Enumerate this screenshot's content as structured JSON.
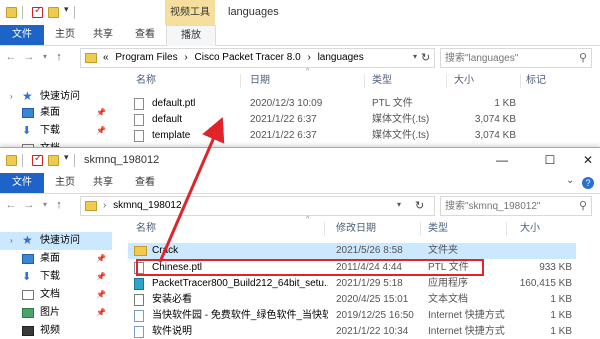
{
  "colors": {
    "accent": "#1e64c8",
    "context_tab": "#f6df9d",
    "selection": "#cce8ff",
    "highlight": "#e0242a"
  },
  "window1": {
    "title": "languages",
    "context_tab": "视频工具",
    "tabs": [
      "文件",
      "主页",
      "共享",
      "查看",
      "播放"
    ],
    "path": [
      "«",
      "Program Files",
      "›",
      "Cisco Packet Tracer 8.0",
      "›",
      "languages"
    ],
    "search_placeholder": "搜索\"languages\"",
    "columns": [
      "名称",
      "日期",
      "类型",
      "大小",
      "标记"
    ],
    "sidebar": [
      "快速访问",
      "桌面",
      "下载",
      "文档"
    ],
    "files": [
      {
        "name": "default.ptl",
        "date": "2020/12/3 10:09",
        "type": "PTL 文件",
        "size": "1 KB",
        "icon": "file-icon"
      },
      {
        "name": "default",
        "date": "2021/1/22 6:37",
        "type": "媒体文件(.ts)",
        "size": "3,074 KB",
        "icon": "file-icon"
      },
      {
        "name": "template",
        "date": "2021/1/22 6:37",
        "type": "媒体文件(.ts)",
        "size": "3,074 KB",
        "icon": "file-icon"
      }
    ]
  },
  "window2": {
    "title": "skmnq_198012",
    "tabs": [
      "文件",
      "主页",
      "共享",
      "查看"
    ],
    "path": [
      "skmnq_198012"
    ],
    "search_placeholder": "搜索\"skmnq_198012\"",
    "columns": [
      "名称",
      "修改日期",
      "类型",
      "大小"
    ],
    "sidebar": [
      "快速访问",
      "桌面",
      "下载",
      "文档",
      "图片",
      "视频"
    ],
    "files": [
      {
        "name": "Crack",
        "date": "2021/5/26 8:58",
        "type": "文件夹",
        "size": "",
        "icon": "folder-icon"
      },
      {
        "name": "Chinese.ptl",
        "date": "2011/4/24 4:44",
        "type": "PTL 文件",
        "size": "933 KB",
        "icon": "file-icon"
      },
      {
        "name": "PacketTracer800_Build212_64bit_setu...",
        "date": "2021/1/29 5:18",
        "type": "应用程序",
        "size": "160,415 KB",
        "icon": "app-icon"
      },
      {
        "name": "安装必看",
        "date": "2020/4/25 15:01",
        "type": "文本文档",
        "size": "1 KB",
        "icon": "text-document-icon"
      },
      {
        "name": "当快软件园 - 免费软件_绿色软件_当快软...",
        "date": "2019/12/25 16:50",
        "type": "Internet 快捷方式",
        "size": "1 KB",
        "icon": "web-shortcut-icon"
      },
      {
        "name": "软件说明",
        "date": "2021/1/22 10:34",
        "type": "Internet 快捷方式",
        "size": "1 KB",
        "icon": "web-shortcut-icon"
      }
    ]
  }
}
